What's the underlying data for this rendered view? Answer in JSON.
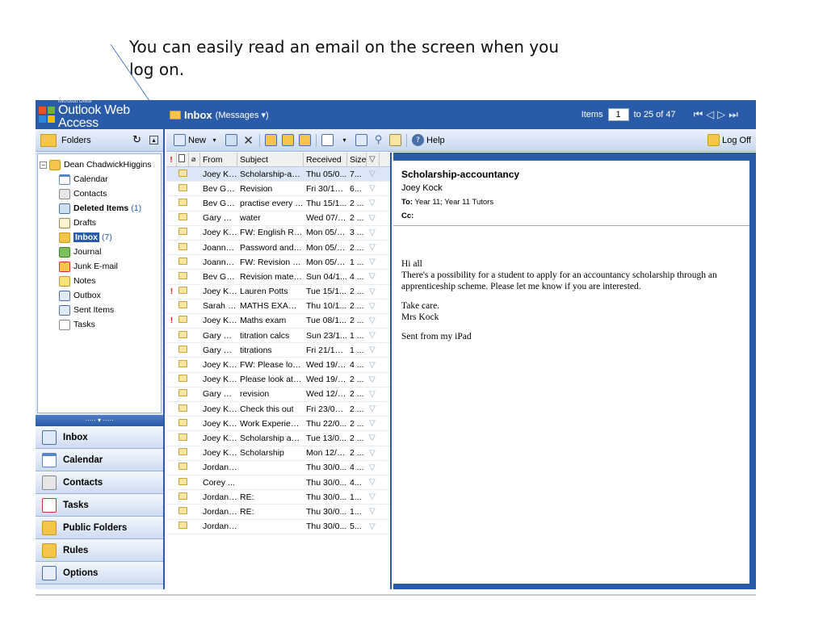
{
  "caption": "You can easily read an email on the screen when you log on.",
  "header": {
    "logo_small": "Microsoft Office",
    "logo_main": "Outlook Web Access",
    "inbox_title": "Inbox",
    "inbox_sub": "(Messages ▾)",
    "items_label": "Items",
    "items_page": "1",
    "items_range": "to 25 of 47"
  },
  "folders": {
    "header": "Folders",
    "user": "Dean ChadwickHiggins",
    "items": [
      {
        "label": "Calendar",
        "count": ""
      },
      {
        "label": "Contacts",
        "count": ""
      },
      {
        "label": "Deleted Items",
        "count": "(1)"
      },
      {
        "label": "Drafts",
        "count": ""
      },
      {
        "label": "Inbox",
        "count": "(7)"
      },
      {
        "label": "Journal",
        "count": ""
      },
      {
        "label": "Junk E-mail",
        "count": ""
      },
      {
        "label": "Notes",
        "count": ""
      },
      {
        "label": "Outbox",
        "count": ""
      },
      {
        "label": "Sent Items",
        "count": ""
      },
      {
        "label": "Tasks",
        "count": ""
      }
    ]
  },
  "nav": {
    "separator": "····· ▾ ·····",
    "items": [
      "Inbox",
      "Calendar",
      "Contacts",
      "Tasks",
      "Public Folders",
      "Rules",
      "Options"
    ]
  },
  "toolbar": {
    "new_label": "New",
    "help_label": "Help",
    "logoff_label": "Log Off"
  },
  "list": {
    "headers": {
      "from": "From",
      "subject": "Subject",
      "received": "Received",
      "size": "Size"
    },
    "rows": [
      {
        "imp": "",
        "from": "Joey Ko...",
        "subject": "Scholarship-acc...",
        "received": "Thu 05/0...",
        "size": "7..."
      },
      {
        "imp": "",
        "from": "Bev Gra...",
        "subject": "Revision",
        "received": "Fri 30/12/...",
        "size": "6..."
      },
      {
        "imp": "",
        "from": "Bev Gra...",
        "subject": "practise every q...",
        "received": "Thu 15/1...",
        "size": "2 ..."
      },
      {
        "imp": "",
        "from": "Gary C....",
        "subject": "water",
        "received": "Wed 07/1...",
        "size": "2 ..."
      },
      {
        "imp": "",
        "from": "Joey Ko...",
        "subject": "FW: English Rev...",
        "received": "Mon 05/1...",
        "size": "3 ..."
      },
      {
        "imp": "",
        "from": "Joanna ...",
        "subject": "Password and A...",
        "received": "Mon 05/1...",
        "size": "2 ..."
      },
      {
        "imp": "",
        "from": "Joanna ...",
        "subject": "FW: Revision m...",
        "received": "Mon 05/1...",
        "size": "1 ..."
      },
      {
        "imp": "",
        "from": "Bev Gra...",
        "subject": "Revision materi...",
        "received": "Sun 04/1...",
        "size": "4 ..."
      },
      {
        "imp": "!",
        "from": "Joey Ko...",
        "subject": "Lauren Potts",
        "received": "Tue 15/1...",
        "size": "2 ..."
      },
      {
        "imp": "",
        "from": "Sarah R...",
        "subject": "MATHS EXAM - ...",
        "received": "Thu 10/1...",
        "size": "2 ..."
      },
      {
        "imp": "!",
        "from": "Joey Ko...",
        "subject": "Maths exam",
        "received": "Tue 08/1...",
        "size": "2 ..."
      },
      {
        "imp": "",
        "from": "Gary C....",
        "subject": "titration calcs",
        "received": "Sun 23/1...",
        "size": "1 ..."
      },
      {
        "imp": "",
        "from": "Gary C....",
        "subject": "titrations",
        "received": "Fri 21/10/...",
        "size": "1 ..."
      },
      {
        "imp": "",
        "from": "Joey Ko...",
        "subject": "FW: Please look...",
        "received": "Wed 19/1...",
        "size": "4 ..."
      },
      {
        "imp": "",
        "from": "Joey Ko...",
        "subject": "Please look at this",
        "received": "Wed 19/1...",
        "size": "2 ..."
      },
      {
        "imp": "",
        "from": "Gary C....",
        "subject": "revision",
        "received": "Wed 12/1...",
        "size": "2 ..."
      },
      {
        "imp": "",
        "from": "Joey Ko...",
        "subject": "Check this out",
        "received": "Fri 23/09/...",
        "size": "2 ..."
      },
      {
        "imp": "",
        "from": "Joey Ko...",
        "subject": "Work Experience",
        "received": "Thu 22/0...",
        "size": "2 ..."
      },
      {
        "imp": "",
        "from": "Joey Ko...",
        "subject": "Scholarship and ...",
        "received": "Tue 13/0...",
        "size": "2 ..."
      },
      {
        "imp": "",
        "from": "Joey Ko...",
        "subject": "Scholarship",
        "received": "Mon 12/0...",
        "size": "2 ..."
      },
      {
        "imp": "",
        "from": "Jordan ...",
        "subject": "",
        "received": "Thu 30/0...",
        "size": "4 ..."
      },
      {
        "imp": "",
        "from": "Corey ...",
        "subject": "",
        "received": "Thu 30/0...",
        "size": "4..."
      },
      {
        "imp": "",
        "from": "Jordan ...",
        "subject": "RE:",
        "received": "Thu 30/0...",
        "size": "1..."
      },
      {
        "imp": "",
        "from": "Jordan ...",
        "subject": "RE:",
        "received": "Thu 30/0...",
        "size": "1..."
      },
      {
        "imp": "",
        "from": "Jordan ...",
        "subject": "",
        "received": "Thu 30/0...",
        "size": "5..."
      }
    ]
  },
  "reading": {
    "subject": "Scholarship-accountancy",
    "from": "Joey Kock",
    "to_label": "To:",
    "to": "Year 11; Year 11 Tutors",
    "cc_label": "Cc:",
    "body_greeting": "Hi all",
    "body_text": "There's a possibility for a student to apply for an accountancy scholarship through an apprenticeship scheme.  Please let me know if you are interested.",
    "body_signoff1": "Take care.",
    "body_signoff2": "Mrs Kock",
    "body_sent": "Sent from my iPad"
  },
  "colors": {
    "brand_blue": "#2a5ba8",
    "panel_light": "#dfe9f7",
    "important_red": "#dd2222"
  }
}
